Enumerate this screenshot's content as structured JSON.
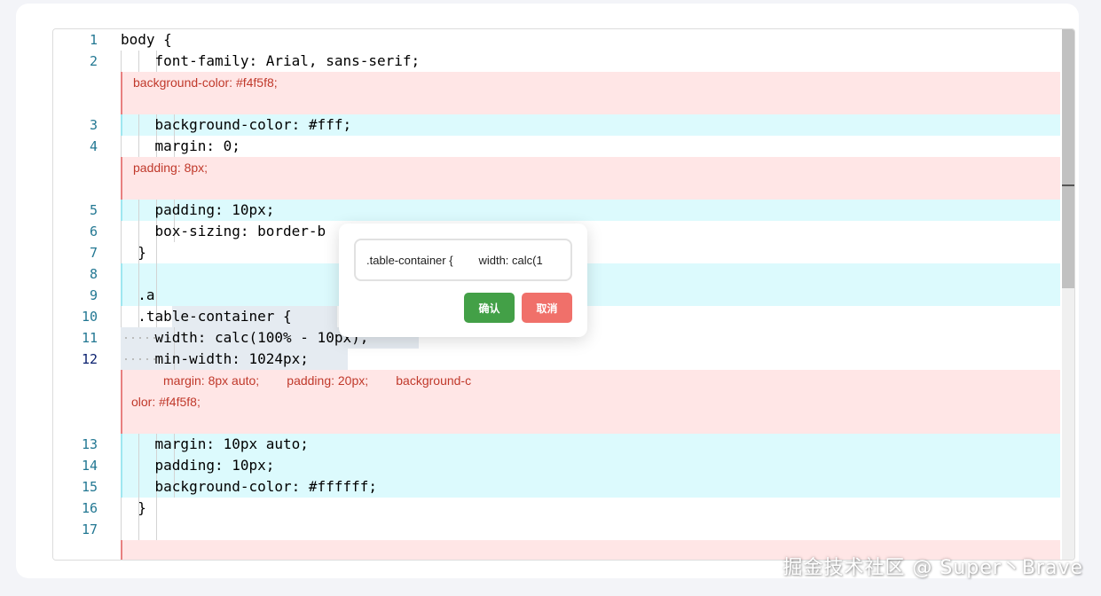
{
  "editor": {
    "lines": [
      {
        "no": "1",
        "text": "body {"
      },
      {
        "no": "2",
        "text": "    font-family: Arial, sans-serif;"
      },
      {
        "removed": "background-color: #f4f5f8;"
      },
      {
        "no": "3",
        "text": "    background-color: #fff;"
      },
      {
        "no": "4",
        "text": "    margin: 0;"
      },
      {
        "removed": "padding: 8px;"
      },
      {
        "no": "5",
        "text": "    padding: 10px;"
      },
      {
        "no": "6",
        "text": "    box-sizing: border-b"
      },
      {
        "no": "7",
        "text": "  }"
      },
      {
        "no": "8",
        "text": ""
      },
      {
        "no": "9",
        "text": "  .a"
      },
      {
        "no": "10",
        "text": "  .table-container {"
      },
      {
        "no": "11",
        "text": "    width: calc(100% - 10px);"
      },
      {
        "no": "12",
        "text": "    min-width: 1024px;"
      },
      {
        "removed": "margin: 8px auto;        padding: 20px;        background-color: #f4f5f8;"
      },
      {
        "no": "13",
        "text": "    margin: 10px auto;"
      },
      {
        "no": "14",
        "text": "    padding: 10px;"
      },
      {
        "no": "15",
        "text": "    background-color: #ffffff;"
      },
      {
        "no": "16",
        "text": "  }"
      },
      {
        "no": "17",
        "text": ""
      }
    ]
  },
  "popup": {
    "input_value": ".table-container {        width: calc(1",
    "confirm_label": "确认",
    "cancel_label": "取消"
  },
  "watermark": "掘金技术社区 @ Super丶Brave",
  "colors": {
    "added_bg": "#dcfafd",
    "removed_bg": "#ffe6e6",
    "removed_text": "#c0392b",
    "line_number": "#237893",
    "confirm_button": "#43a047",
    "cancel_button": "#f0706a"
  }
}
